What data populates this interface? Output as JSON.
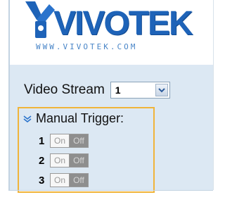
{
  "header": {
    "brand": "VIVOTEK",
    "url": "WWW.VIVOTEK.COM",
    "brand_color": "#1e63b8"
  },
  "stream": {
    "label": "Video Stream",
    "selected": "1"
  },
  "manual_trigger": {
    "title": "Manual Trigger:",
    "rows": [
      {
        "number": "1",
        "on_label": "On",
        "off_label": "Off"
      },
      {
        "number": "2",
        "on_label": "On",
        "off_label": "Off"
      },
      {
        "number": "3",
        "on_label": "On",
        "off_label": "Off"
      }
    ],
    "border_color": "#f0b43a"
  },
  "colors": {
    "panel_background": "#dce8f3",
    "off_active": "#8e8e8e"
  },
  "icons": {
    "logo_mark": "vivotek-camera-logo-icon",
    "dropdown": "chevron-down-icon",
    "expand": "double-chevron-down-icon"
  }
}
